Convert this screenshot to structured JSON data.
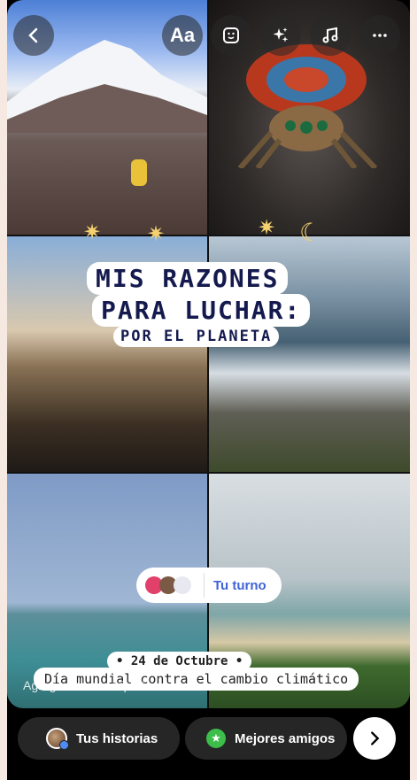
{
  "topbar": {
    "back_icon": "chevron-left-icon",
    "text_label": "Aa",
    "sticker_icon": "sticker-icon",
    "effects_icon": "sparkles-icon",
    "music_icon": "music-note-icon",
    "more_icon": "more-horizontal-icon"
  },
  "sticker_title": {
    "line1": "MIS RAZONES",
    "line2": "PARA LUCHAR:",
    "line3": "POR EL PLANETA"
  },
  "your_turn": {
    "label": "Tu turno"
  },
  "date_sticker": {
    "line1": "• 24 de Octubre •",
    "line2": "Día mundial contra el cambio climático"
  },
  "caption": {
    "placeholder": "Agrega una descripción..."
  },
  "bottom": {
    "your_stories": "Tus historias",
    "close_friends": "Mejores amigos",
    "next_icon": "chevron-right-icon"
  },
  "colors": {
    "accent": "#3f63d8",
    "close_friends_green": "#3dbd4a",
    "title_text": "#141a4d"
  }
}
